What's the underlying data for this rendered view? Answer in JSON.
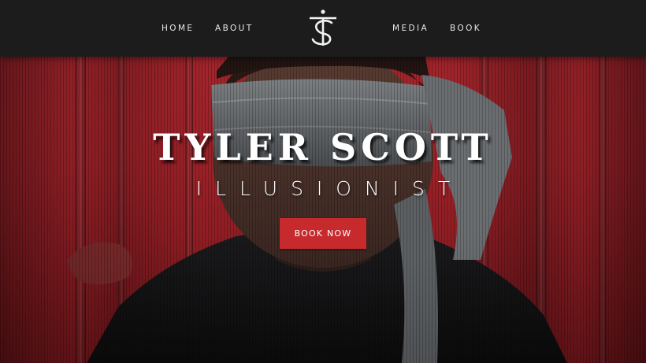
{
  "nav": {
    "home": "HOME",
    "about": "ABOUT",
    "media": "MEDIA",
    "book": "BOOK"
  },
  "hero": {
    "title": "TYLER SCOTT",
    "subtitle": "ILLUSIONIST",
    "cta_label": "BOOK NOW"
  },
  "colors": {
    "navbar": "#1d1c1d",
    "accent": "#c62a2d",
    "curtain": "#9a2128"
  },
  "icons": {
    "logo": "ts-monogram-logo"
  }
}
